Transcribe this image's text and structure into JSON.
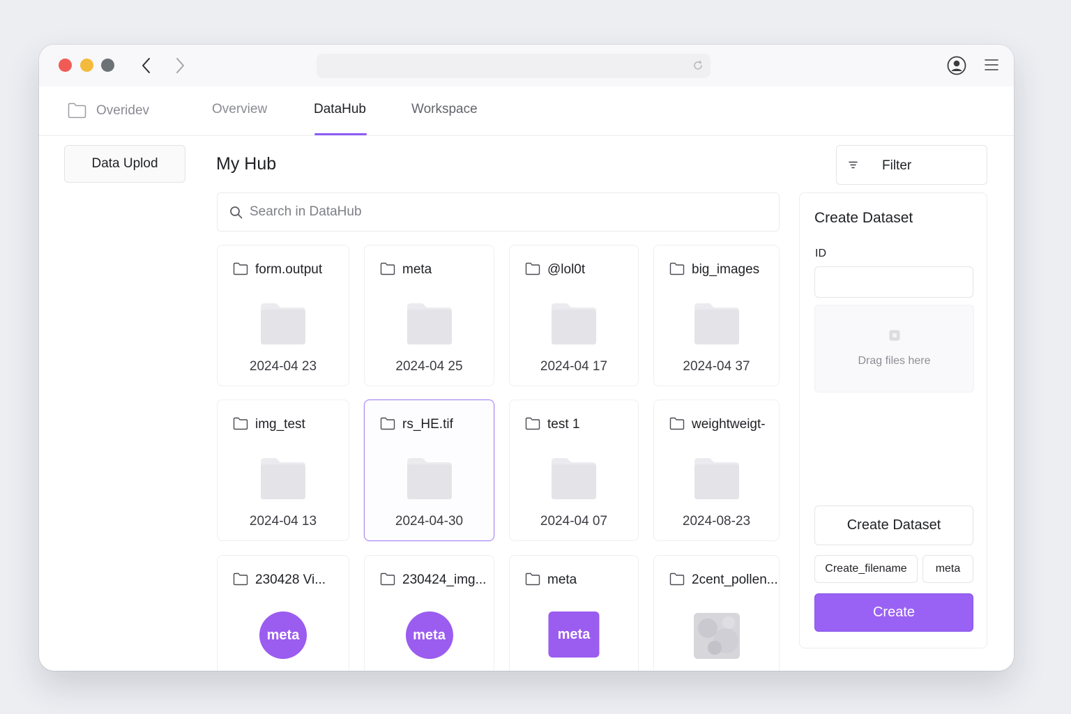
{
  "titlebar": {
    "icons": [
      "chevron-left-icon",
      "chevron-right-icon",
      "reload-icon",
      "user-circle-icon",
      "hamburger-menu-icon"
    ],
    "url": ""
  },
  "topnav": {
    "brand": "Overidev",
    "tabs": [
      "Overview",
      "DataHub",
      "Workspace"
    ],
    "active_tab": "DataHub"
  },
  "sidebar": {
    "upload_label": "Data Uplod"
  },
  "main": {
    "title": "My Hub",
    "filter_label": "Filter",
    "search_placeholder": "Search in DataHub",
    "cards": [
      {
        "name": "form.output",
        "date": "2024-04 23",
        "thumb": "folder"
      },
      {
        "name": "meta",
        "date": "2024-04 25",
        "thumb": "folder"
      },
      {
        "name": "@lol0t",
        "date": "2024-04 17",
        "thumb": "folder"
      },
      {
        "name": "big_images",
        "date": "2024-04 37",
        "thumb": "folder"
      },
      {
        "name": "img_test",
        "date": "2024-04 13",
        "thumb": "folder"
      },
      {
        "name": "rs_HE.tif",
        "date": "2024-04-30",
        "thumb": "folder",
        "selected": true
      },
      {
        "name": "test 1",
        "date": "2024-04 07",
        "thumb": "folder"
      },
      {
        "name": "weightweigt-",
        "date": "2024-08-23",
        "thumb": "folder"
      },
      {
        "name": "230428 Vi...",
        "thumb": "meta-circle",
        "badge": "meta"
      },
      {
        "name": "230424_img...",
        "thumb": "meta-circle",
        "badge": "meta"
      },
      {
        "name": "meta",
        "thumb": "meta-square",
        "badge": "meta"
      },
      {
        "name": "2cent_pollen...",
        "thumb": "image"
      }
    ]
  },
  "create_panel": {
    "title": "Create Dataset",
    "id_label": "ID",
    "id_value": "",
    "drop_label": "Drag files here",
    "create_dataset_label": "Create Dataset",
    "chip_filename": "Create_filename",
    "chip_meta": "meta",
    "create_label": "Create"
  },
  "colors": {
    "accent": "#8b5cf6",
    "meta_badge": "#9b5cf0",
    "create_button": "#9a62f4"
  }
}
